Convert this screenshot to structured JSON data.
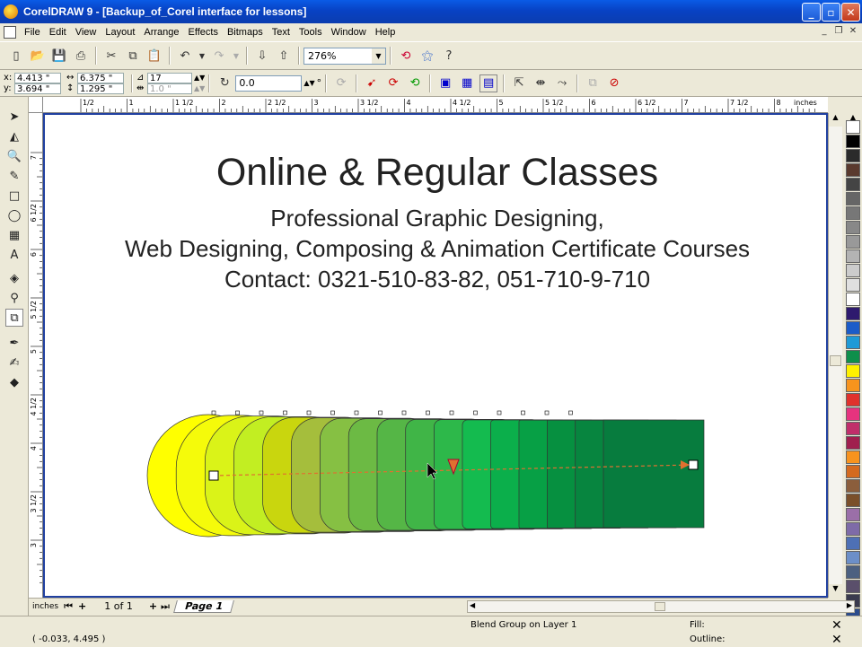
{
  "window": {
    "title": "CorelDRAW 9 - [Backup_of_Corel interface for lessons]"
  },
  "menu": [
    "File",
    "Edit",
    "View",
    "Layout",
    "Arrange",
    "Effects",
    "Bitmaps",
    "Text",
    "Tools",
    "Window",
    "Help"
  ],
  "toolbar": {
    "zoom": "276%"
  },
  "property_bar": {
    "x": "4.413 \"",
    "y": "3.694 \"",
    "width": "6.375 \"",
    "height": "1.295 \"",
    "steps": "17",
    "spacing": "1.0 \"",
    "rotation": "0.0",
    "degree": "°"
  },
  "ruler": {
    "unit": "inches",
    "h_labels": [
      "1/2",
      "1",
      "1 1/2",
      "2",
      "2 1/2",
      "3",
      "3 1/2",
      "4",
      "4 1/2",
      "5",
      "5 1/2",
      "6",
      "6 1/2",
      "7",
      "7 1/2",
      "8"
    ],
    "v_labels": [
      "7",
      "6 1/2",
      "6",
      "5 1/2",
      "5",
      "4 1/2",
      "4",
      "3 1/2",
      "3"
    ],
    "v_unit": "inches"
  },
  "document": {
    "headline": "Online & Regular Classes",
    "line1": "Professional Graphic Designing,",
    "line2": "Web Designing, Composing & Animation Certificate Courses",
    "line3": "Contact: 0321-510-83-82, 051-710-9-710"
  },
  "pages": {
    "counter": "1 of 1",
    "tab": "Page 1"
  },
  "status": {
    "coords": "( -0.033, 4.495 )",
    "selection": "Blend Group on Layer 1",
    "fill_label": "Fill:",
    "outline_label": "Outline:"
  },
  "blend_colors": [
    "#FFFF00",
    "#F5FB0A",
    "#DAF318",
    "#C2EE22",
    "#C9D60E",
    "#A5BE3C",
    "#86C043",
    "#6CBA44",
    "#55B646",
    "#40B547",
    "#2DB84A",
    "#14BB4F",
    "#0BAF4B",
    "#07A045",
    "#069040",
    "#07853F",
    "#077C3E"
  ],
  "palette": [
    "#FFFFFF",
    "#000000",
    "#2B2B2B",
    "#5A3A2E",
    "#444444",
    "#666666",
    "#777777",
    "#888888",
    "#999999",
    "#B3B3B3",
    "#CCCCCC",
    "#E0E0E0",
    "#FFFFFF",
    "#2E1A6E",
    "#1B5CC8",
    "#1E9AD6",
    "#0F8F4B",
    "#FFF000",
    "#F7941D",
    "#E0322C",
    "#E6337E",
    "#C02E6A",
    "#A01F4E",
    "#F7931E",
    "#D46A1F",
    "#8B5E3C",
    "#7A4F2A",
    "#9B6FA8",
    "#7E6BA8",
    "#4E70B5",
    "#6C8FC8",
    "#4C6080",
    "#5A4F6B",
    "#3A3A4E",
    "#2C4C8C",
    "#1A8FC8"
  ]
}
